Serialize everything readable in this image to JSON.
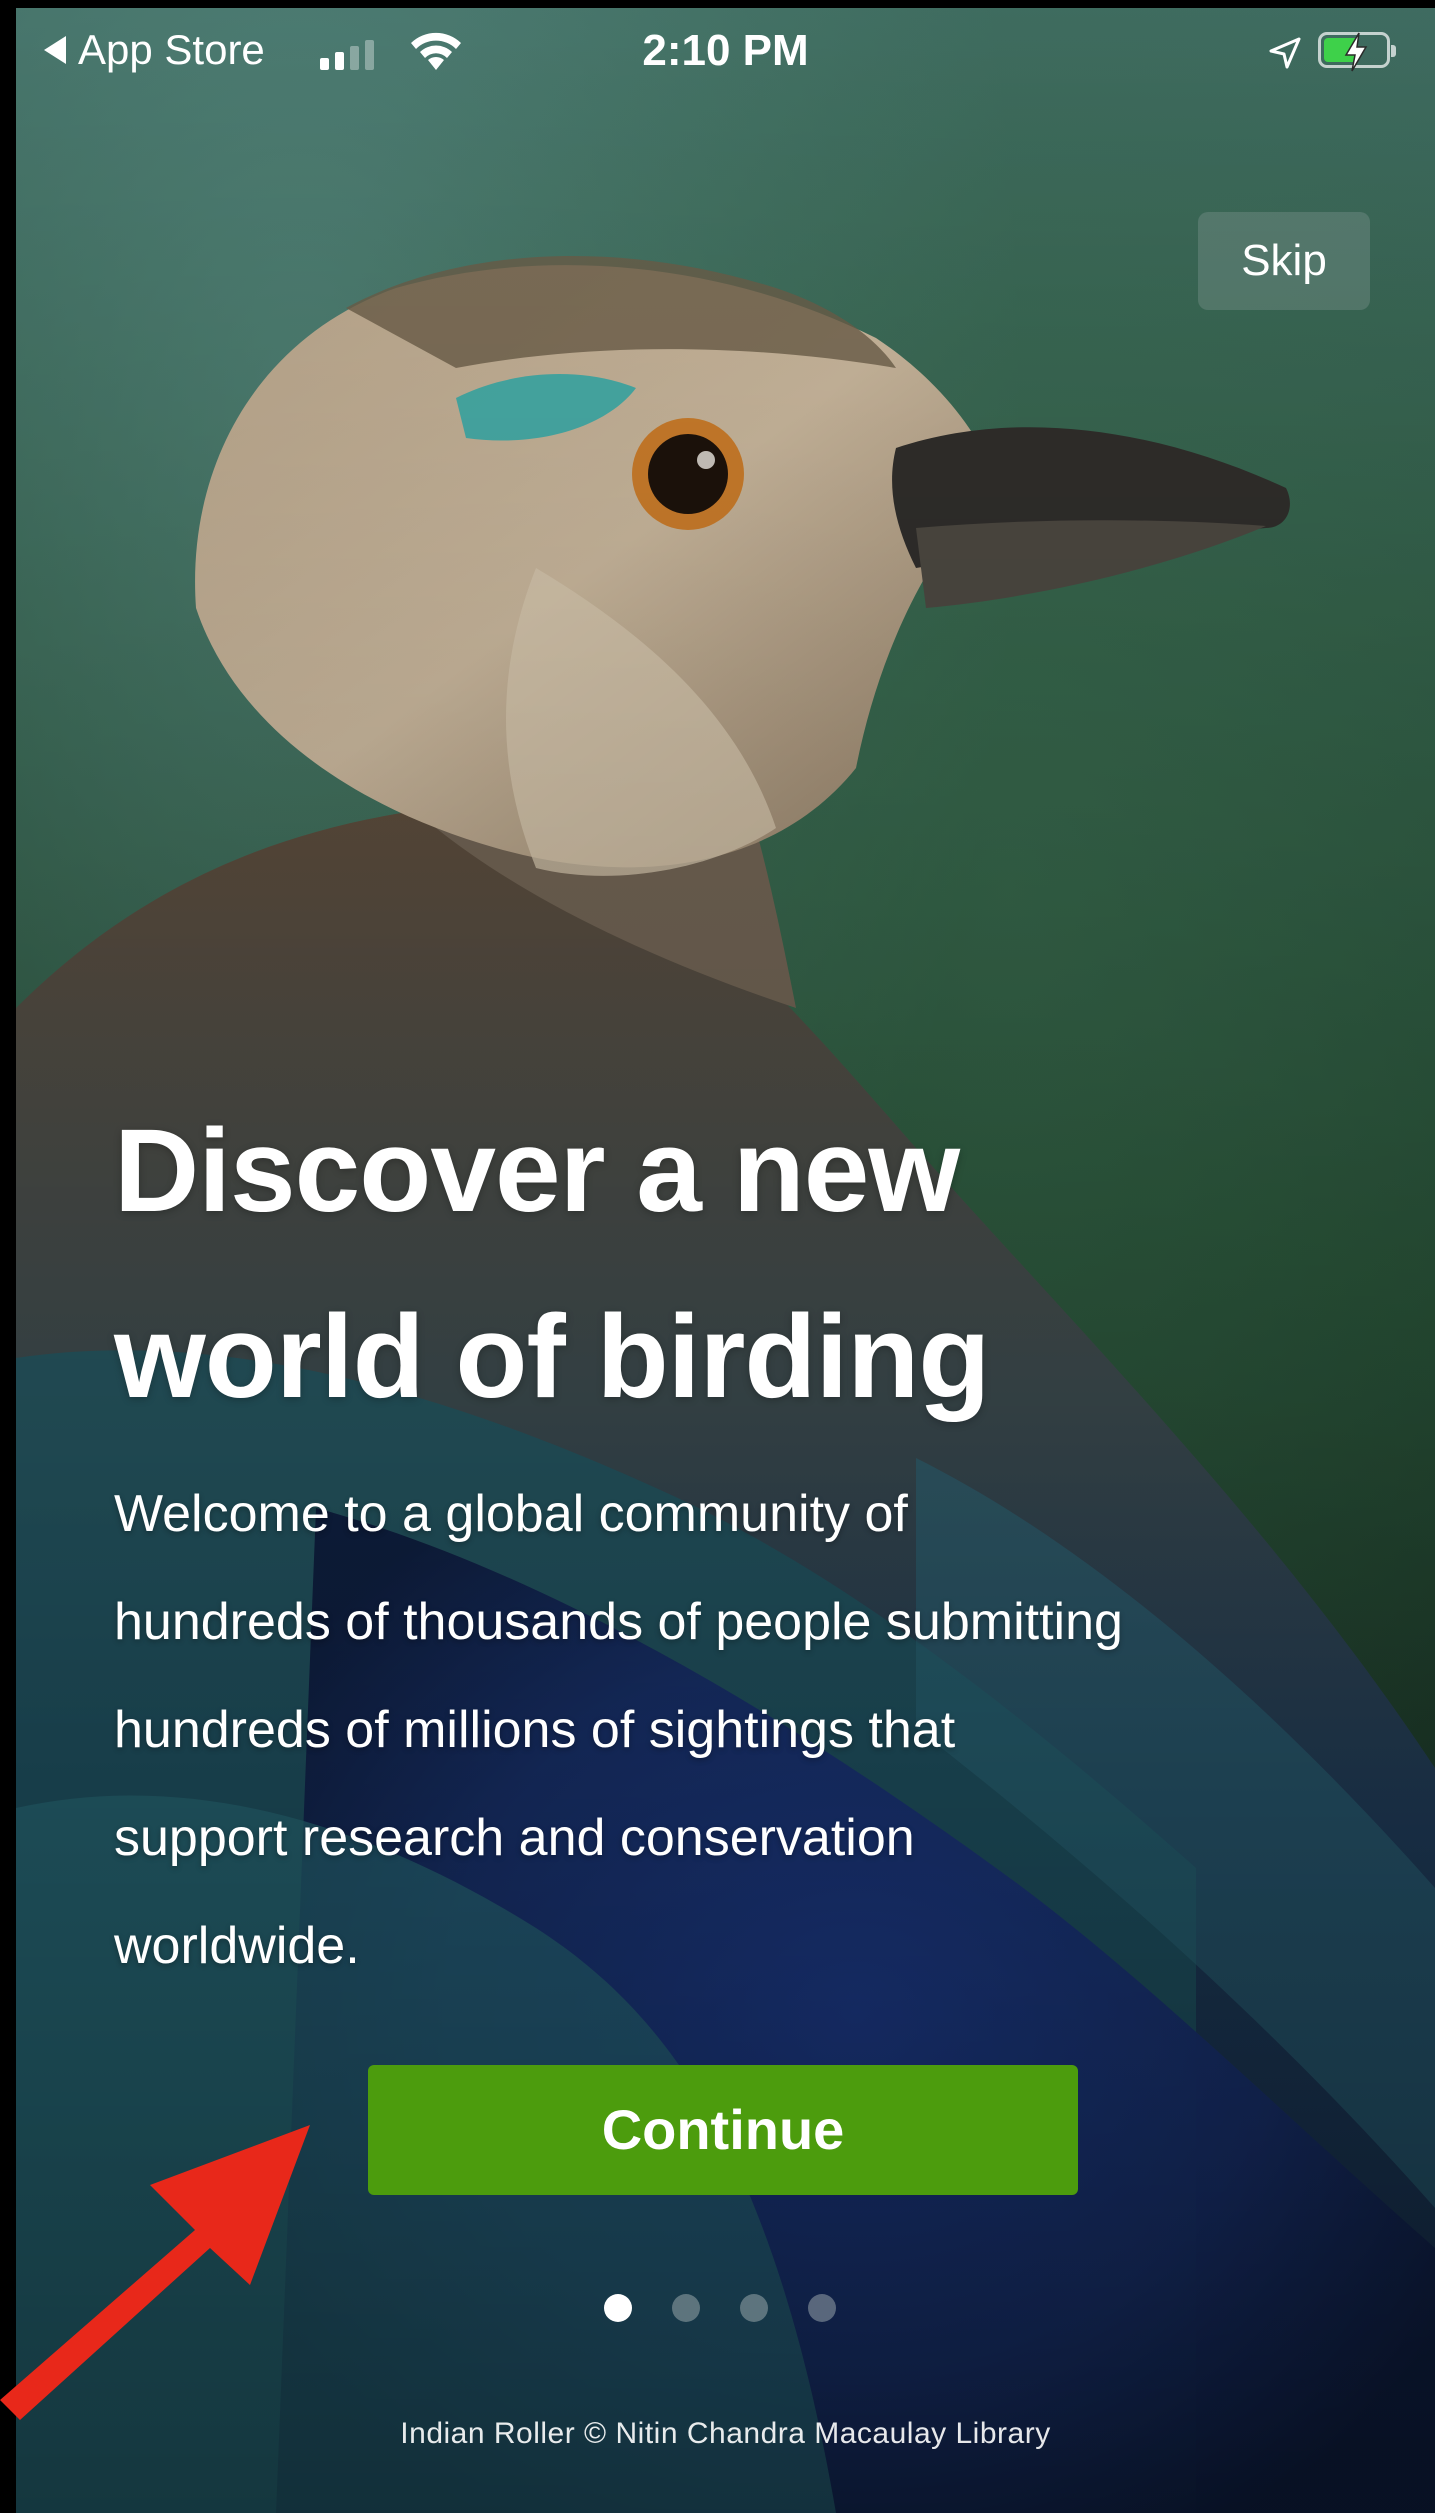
{
  "status_bar": {
    "back_label": "App Store",
    "time": "2:10 PM",
    "signal_bars_active": 2,
    "signal_bars_total": 4,
    "battery_level_percent": 58,
    "battery_charging": true,
    "icons": [
      "back-arrow-icon",
      "signal-icon",
      "wifi-icon",
      "location-icon",
      "battery-icon",
      "charging-bolt-icon"
    ]
  },
  "onboarding": {
    "skip_label": "Skip",
    "headline_line1": "Discover a new",
    "headline_line2": "world of birding",
    "body_line1": "Welcome to a global community of",
    "body_line2": "hundreds of thousands of people submitting",
    "body_line3": "hundreds of millions of sightings that",
    "body_line4": "support research and conservation",
    "body_line5": "worldwide.",
    "continue_label": "Continue",
    "page_count": 4,
    "current_page": 1,
    "photo_credit": "Indian Roller © Nitin Chandra  Macaulay Library"
  },
  "colors": {
    "continue_button": "#4c9c0d",
    "annotation_arrow": "#e8281a",
    "battery_fill": "#3ed14a"
  }
}
